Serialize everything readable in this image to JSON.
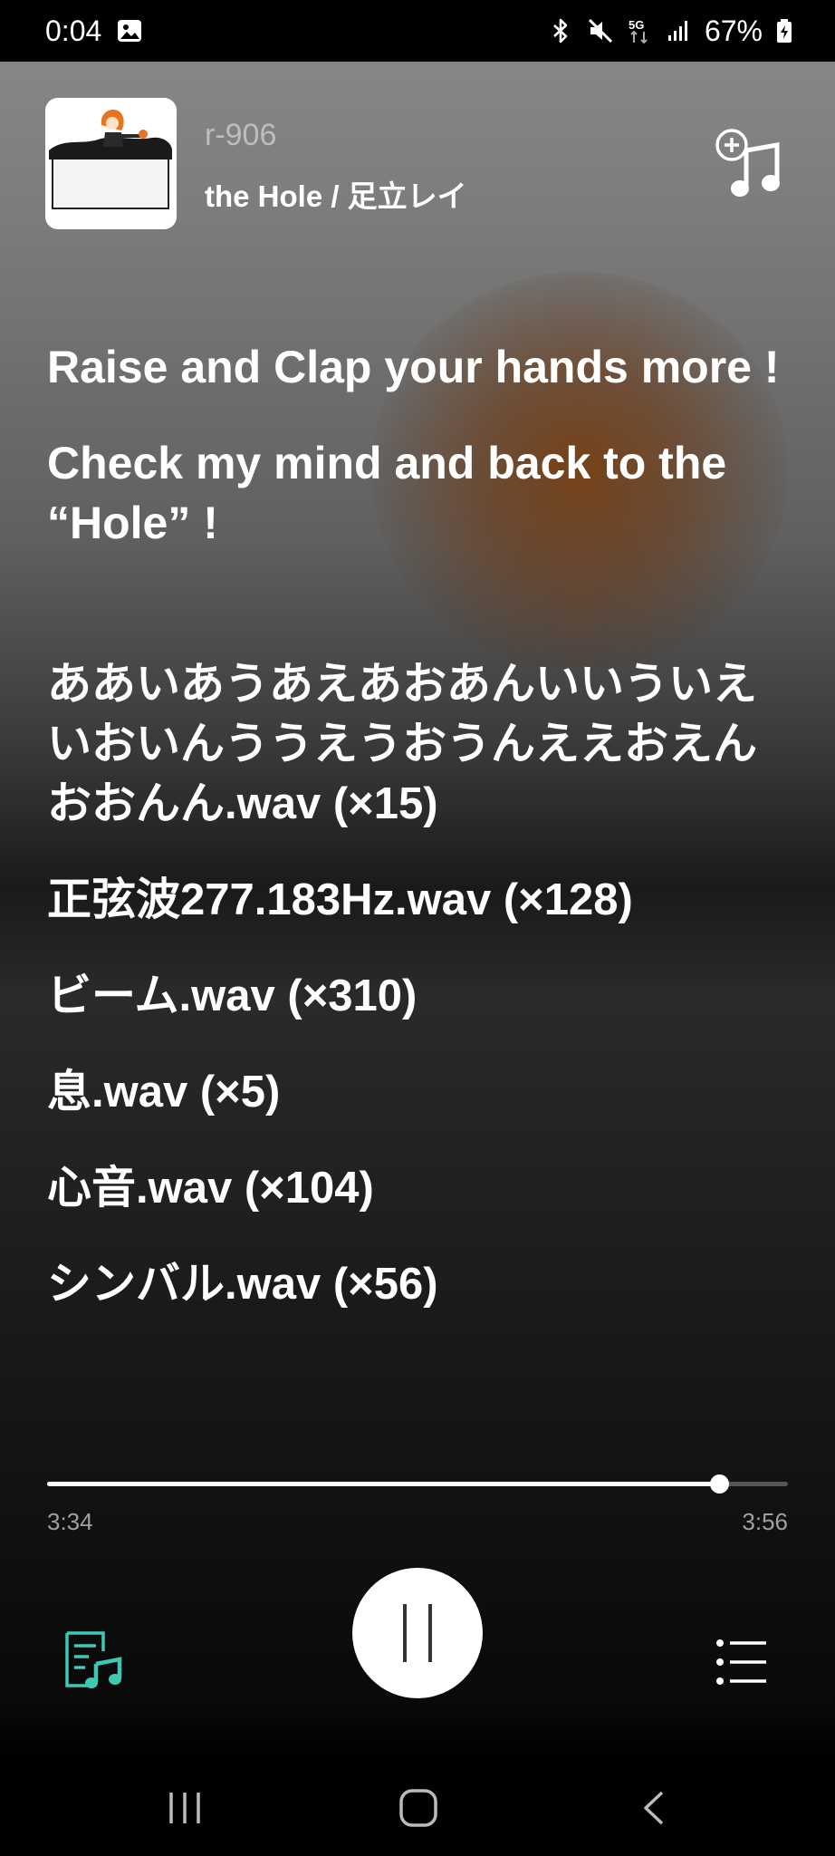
{
  "status_bar": {
    "time": "0:04",
    "battery_percent": "67%",
    "icons": [
      "image-icon",
      "bluetooth-icon",
      "mute-icon",
      "5g-icon",
      "signal-icon",
      "battery-icon"
    ]
  },
  "now_playing": {
    "artist": "r-906",
    "title": "the Hole / 足立レイ"
  },
  "lyrics": [
    "Raise and Clap your hands more !",
    "Check my mind and back to the “Hole” !",
    "ああいあうあえあおあんいいういえいおいんううえうおうんええおえんおおんん.wav (×15)",
    "正弦波277.183Hz.wav (×128)",
    "ビーム.wav (×310)",
    "息.wav (×5)",
    "心音.wav (×104)",
    "シンバル.wav (×56)"
  ],
  "playback": {
    "current_time": "3:34",
    "total_time": "3:56",
    "progress_fraction": 0.9068
  },
  "colors": {
    "accent": "#3ec9b5",
    "background_glow": "#7a3e0c"
  }
}
